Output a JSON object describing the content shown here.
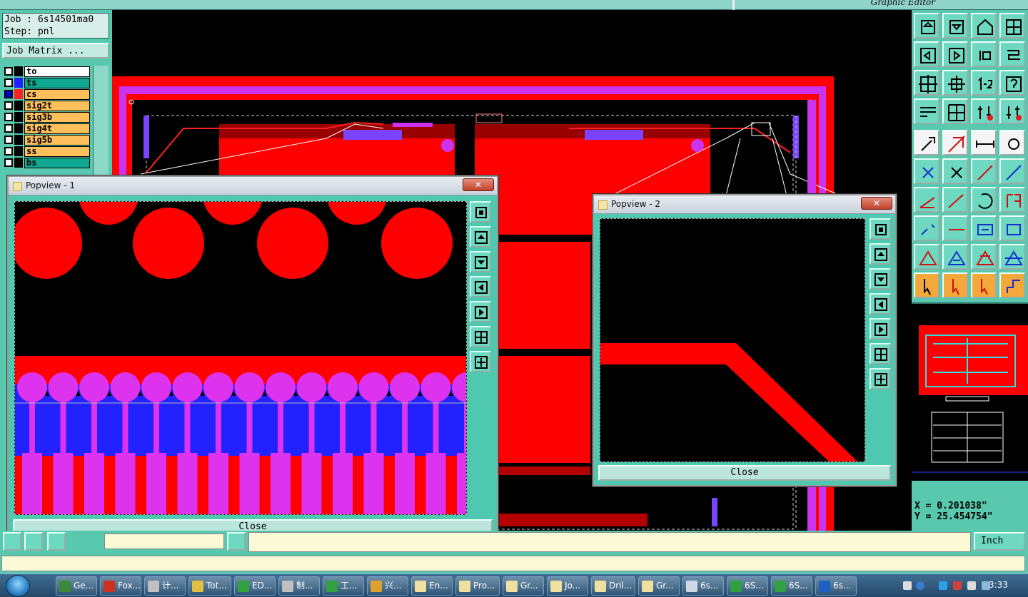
{
  "app": {
    "title": "Graphic Editor"
  },
  "job": {
    "job_line": "Job : 6s14501ma0",
    "step_line": "Step: pnl",
    "matrix_button": "Job Matrix ..."
  },
  "layers": [
    {
      "name": "to",
      "color": "#000000",
      "bg": "#ffffff",
      "selected": false
    },
    {
      "name": "ts",
      "color": "#2020ff",
      "bg": "#10a890",
      "selected": false
    },
    {
      "name": "cs",
      "color": "#ff2020",
      "bg": "#ffbf5a",
      "selected": true
    },
    {
      "name": "sig2t",
      "color": "#000000",
      "bg": "#ffbf5a",
      "selected": false
    },
    {
      "name": "sig3b",
      "color": "#000000",
      "bg": "#ffbf5a",
      "selected": false
    },
    {
      "name": "sig4t",
      "color": "#000000",
      "bg": "#ffbf5a",
      "selected": false
    },
    {
      "name": "sig5b",
      "color": "#000000",
      "bg": "#ffbf5a",
      "selected": false
    },
    {
      "name": "ss",
      "color": "#000000",
      "bg": "#ffbf5a",
      "selected": false
    },
    {
      "name": "bs",
      "color": "#000000",
      "bg": "#10a890",
      "selected": false
    }
  ],
  "popview1": {
    "title": "Popview - 1",
    "close_label": "Close",
    "close_x": "✕"
  },
  "popview2": {
    "title": "Popview - 2",
    "close_label": "Close",
    "close_x": "✕"
  },
  "coords": {
    "x": "X = 0.201038\"",
    "y": "Y = 25.454754\""
  },
  "units": {
    "label": "Inch"
  },
  "taskbar": {
    "items": [
      {
        "label": "Ge...",
        "icon": "#3a8a3a"
      },
      {
        "label": "Fox...",
        "icon": "#d03020"
      },
      {
        "label": "计...",
        "icon": "#c0c0c0"
      },
      {
        "label": "Tot...",
        "icon": "#e0c040"
      },
      {
        "label": "ED...",
        "icon": "#30a040"
      },
      {
        "label": "制...",
        "icon": "#c0c0c0"
      },
      {
        "label": "工...",
        "icon": "#30a040"
      },
      {
        "label": "兴...",
        "icon": "#e0a030"
      },
      {
        "label": "En...",
        "icon": "#f0e0a0"
      },
      {
        "label": "Pro...",
        "icon": "#f0e0a0"
      },
      {
        "label": "Gr...",
        "icon": "#f0e0a0"
      },
      {
        "label": "Jo...",
        "icon": "#f0e0a0"
      },
      {
        "label": "Dril...",
        "icon": "#f0e0a0"
      },
      {
        "label": "Gr...",
        "icon": "#f0e0a0"
      },
      {
        "label": "6s...",
        "icon": "#d0d8e8"
      },
      {
        "label": "6S...",
        "icon": "#30a040"
      },
      {
        "label": "6S...",
        "icon": "#30a040"
      },
      {
        "label": "6s...",
        "icon": "#2060c0"
      }
    ],
    "clock": "3:33"
  }
}
